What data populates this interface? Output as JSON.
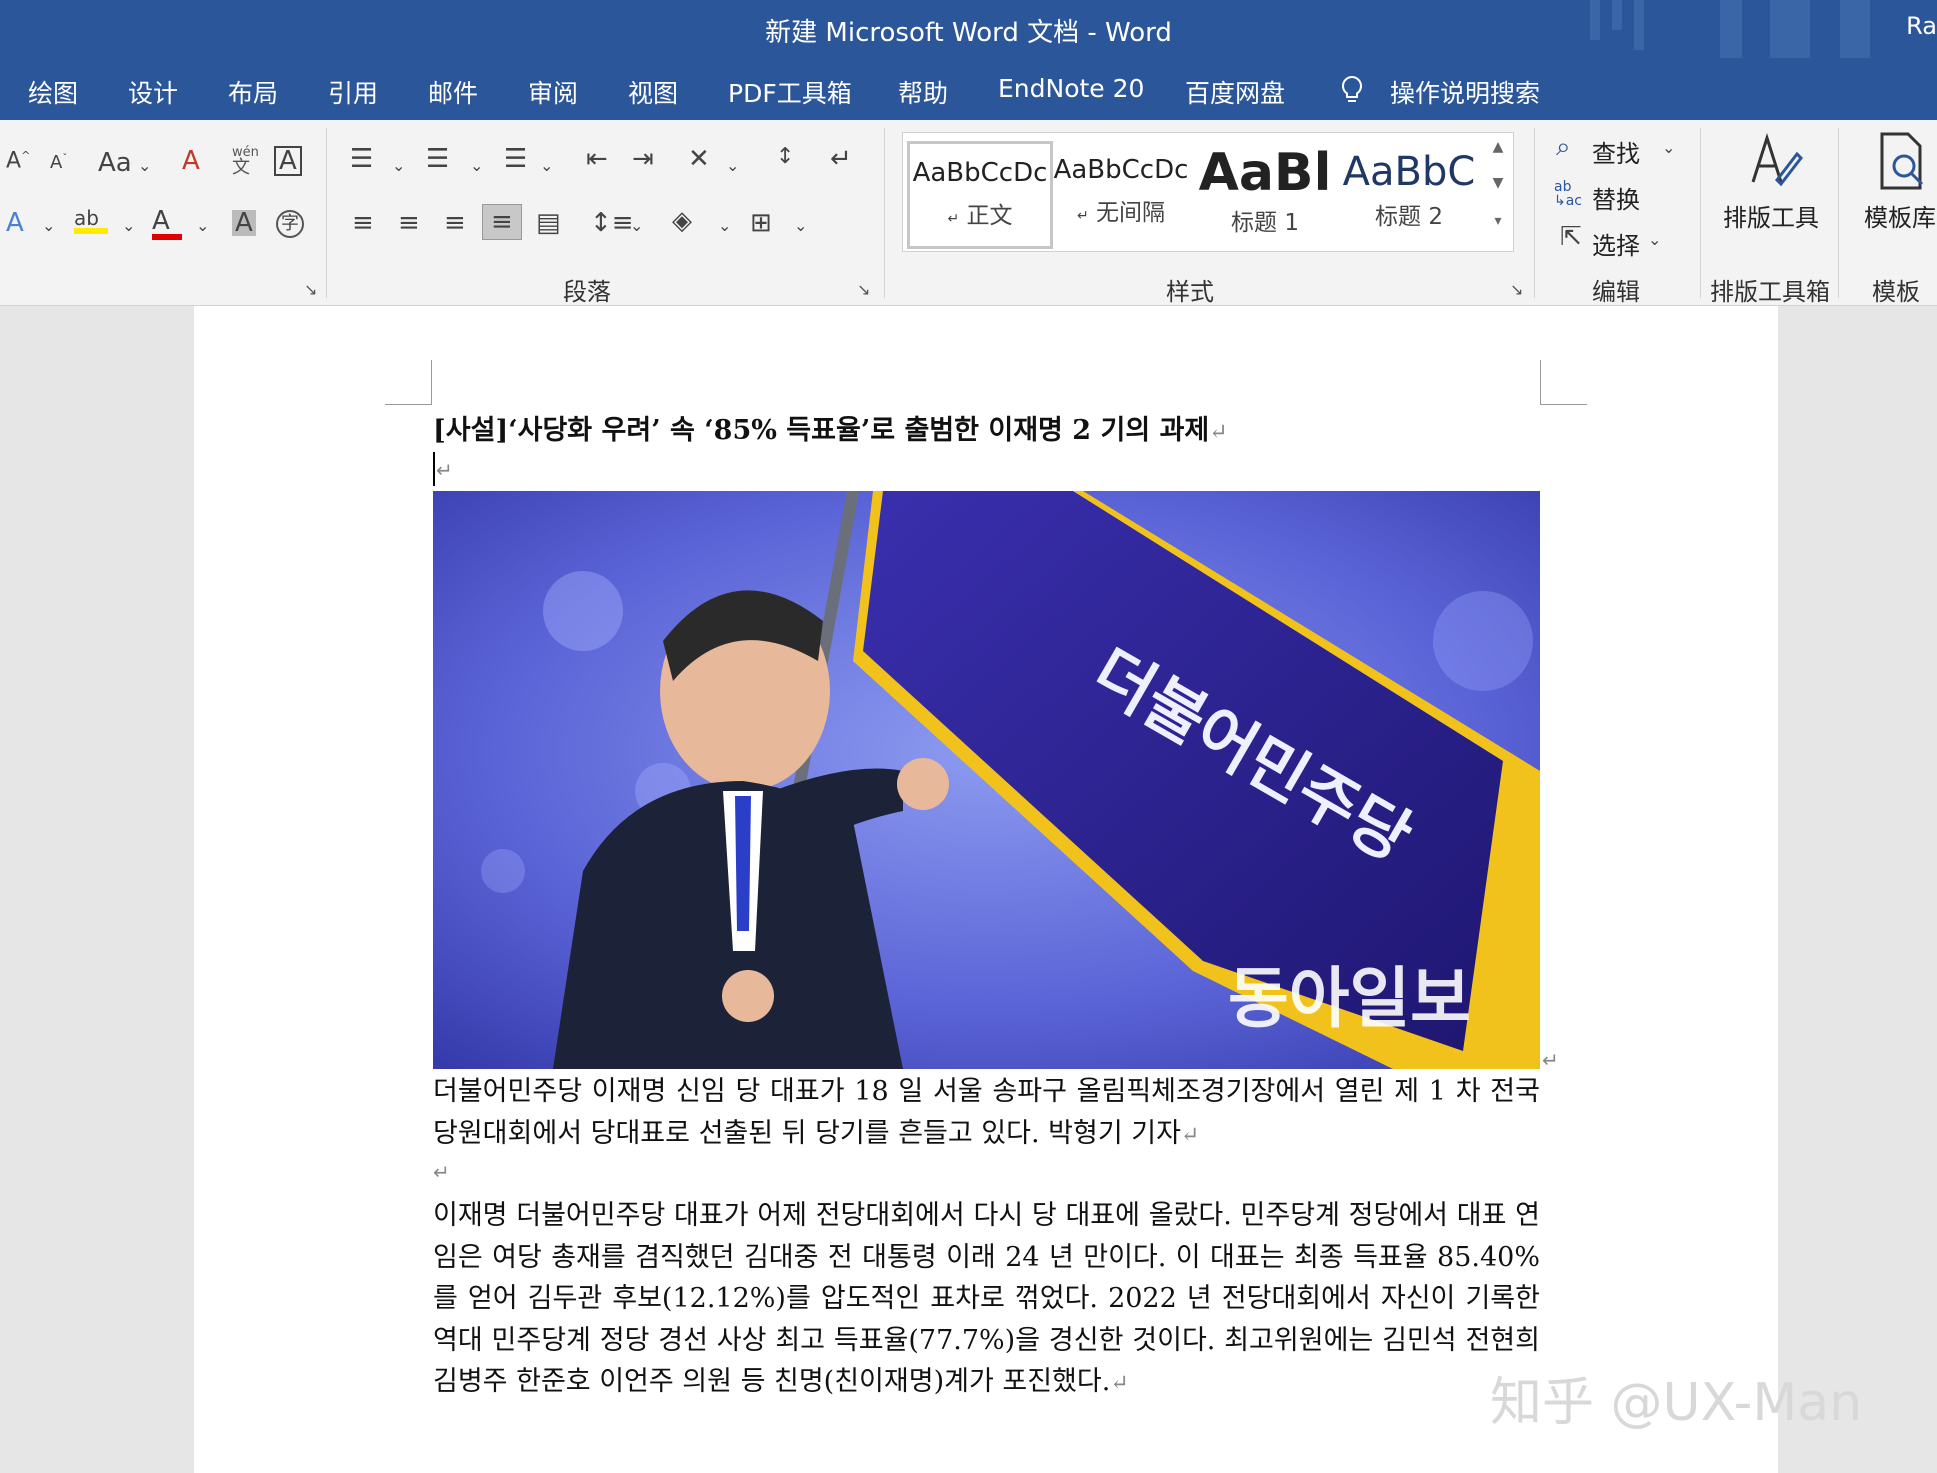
{
  "window": {
    "title": "新建 Microsoft Word 文档  -  Word",
    "user_initials": "Ra"
  },
  "menu": {
    "tabs": [
      "绘图",
      "设计",
      "布局",
      "引用",
      "邮件",
      "审阅",
      "视图",
      "PDF工具箱",
      "帮助",
      "EndNote 20",
      "百度网盘"
    ],
    "tell_me": "操作说明搜索"
  },
  "ribbon": {
    "font": {
      "change_case": "Aa",
      "phonetic_top": "wén",
      "phonetic_bottom": "文",
      "char_border": "A",
      "clear_format": "A",
      "font_color": "A",
      "char_shade": "A",
      "enclose": "字"
    },
    "paragraph": {
      "label": "段落"
    },
    "styles": {
      "label": "样式",
      "items": [
        {
          "preview": "AaBbCcDc",
          "name": "正文",
          "selected": true
        },
        {
          "preview": "AaBbCcDc",
          "name": "无间隔",
          "selected": false
        },
        {
          "preview": "AaBl",
          "name": "标题 1",
          "selected": false
        },
        {
          "preview": "AaBbC",
          "name": "标题 2",
          "selected": false
        }
      ]
    },
    "editing": {
      "label": "编辑",
      "find": "查找",
      "replace": "替换",
      "select": "选择"
    },
    "layout_tools": {
      "button": "排版工具",
      "label": "排版工具箱"
    },
    "templates": {
      "button": "模板库",
      "label": "模板"
    }
  },
  "document": {
    "headline": "[사설]‘사당화 우려’ 속 ‘85% 득표율’로 출범한 이재명 2 기의 과제",
    "photo": {
      "flag_text": "더불어민주당",
      "watermark": "동아일보"
    },
    "caption": "더불어민주당 이재명 신임 당 대표가 18 일 서울 송파구 올림픽체조경기장에서 열린 제 1 차 전국당원대회에서 당대표로 선출된 뒤 당기를 흔들고 있다. 박형기 기자",
    "paragraph": "이재명 더불어민주당 대표가 어제 전당대회에서 다시 당 대표에 올랐다. 민주당계 정당에서 대표 연임은 여당 총재를 겸직했던 김대중 전 대통령 이래 24 년 만이다. 이 대표는 최종 득표율 85.40%를 얻어 김두관 후보(12.12%)를 압도적인 표차로 꺾었다. 2022 년 전당대회에서 자신이 기록한 역대 민주당계 정당 경선 사상 최고 득표율(77.7%)을 경신한 것이다. 최고위원에는 김민석 전현희 김병주 한준호 이언주 의원 등 친명(친이재명)계가 포진했다."
  },
  "overlay_watermark": "知乎 @UX-Man"
}
